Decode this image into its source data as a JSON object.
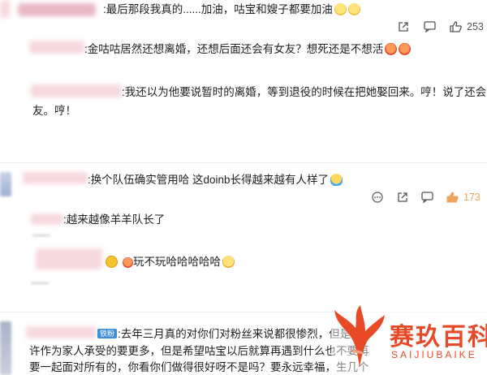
{
  "comments": [
    {
      "badge": "",
      "text": ":最后那段我真的......加油，咕宝和嫂子都要加油",
      "likes": "253"
    },
    {
      "text": ":金咕咕居然还想离婚，还想后面还会有女友？想死还是不想活"
    },
    {
      "text_line1": ":我还以为他要说暂时的离婚，等到退役的时候在把她娶回来。哼！说了还会有女",
      "text_line2": "友。哼！"
    },
    {
      "text": ":换个队伍确实管用哈  这doinb长得越来越有人样了",
      "likes": "173"
    },
    {
      "text": ":越来越像羊羊队长了"
    },
    {
      "text": "玩不玩哈哈哈哈哈"
    },
    {
      "badge": "铁粉",
      "text_line1": ":去年三月真的对你们对粉丝来说都很惨烈，但是",
      "text_line2": "许作为家人承受的要更多，但是希望咕宝以后就算再遇到什么也不要再",
      "text_line3": "要一起面对所有的，你看你们做得很好呀不是吗？要永远幸福，生几个"
    }
  ],
  "watermark": {
    "cn": "赛玖百科",
    "en": "SAIJIUBAIKE"
  },
  "colors": {
    "like_active": "#f0a35b",
    "icon": "#555555",
    "watermark": "#e84a28"
  }
}
